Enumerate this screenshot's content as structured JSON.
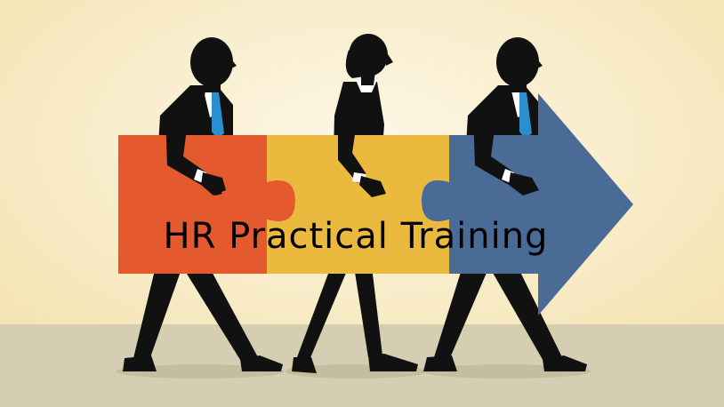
{
  "banner": {
    "title": "HR Practical Training"
  },
  "colors": {
    "background_top": "#fbf3dc",
    "background_bottom": "#f3e1ac",
    "floor": "#d6ceb2",
    "piece_red": "#e45a2e",
    "piece_yellow": "#eab93e",
    "piece_blue": "#4a6b96",
    "suit": "#111111",
    "tie": "#2a8fd0",
    "shirt": "#ffffff"
  },
  "scene": {
    "people": [
      "man",
      "woman",
      "man"
    ],
    "pieces": [
      "red",
      "yellow",
      "blue-arrow"
    ]
  }
}
